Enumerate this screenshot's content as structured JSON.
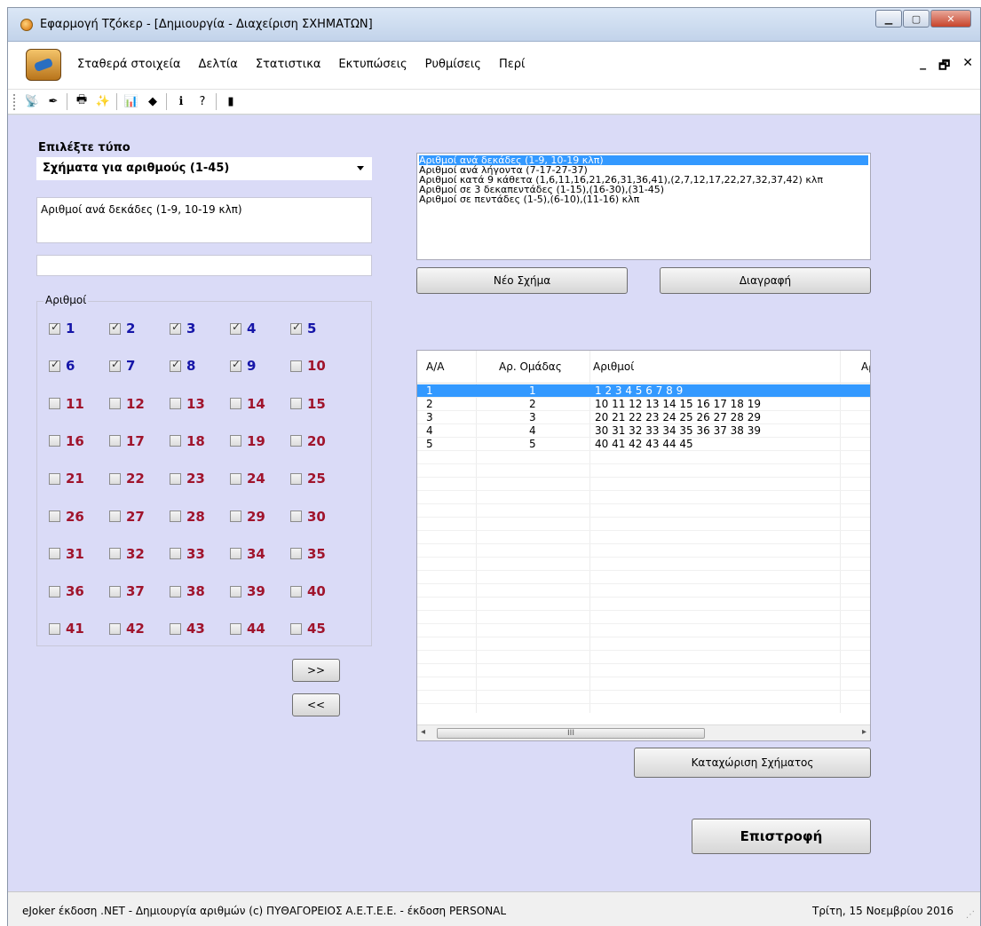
{
  "window": {
    "title": "Εφαρμογή Τζόκερ - [Δημιουργία - Διαχείριση ΣΧΗΜΑΤΩΝ]"
  },
  "menu": [
    "Σταθερά στοιχεία",
    "Δελτία",
    "Στατιστικα",
    "Εκτυπώσεις",
    "Ρυθμίσεις",
    "Περί"
  ],
  "toolbar_icons": [
    "satellite-icon",
    "pen-icon",
    "printer-icon",
    "wand-icon",
    "chart-icon",
    "cube-icon",
    "info-icon",
    "help-icon",
    "exit-door-icon"
  ],
  "left": {
    "type_label": "Επιλέξτε τύπο",
    "type_value": "Σχήματα για αριθμούς (1-45)",
    "description": "Αριθμοί ανά δεκάδες (1-9, 10-19 κλπ)",
    "name_value": "",
    "numbers_legend": "Αριθμοί",
    "numbers": [
      {
        "n": "1",
        "checked": true
      },
      {
        "n": "2",
        "checked": true
      },
      {
        "n": "3",
        "checked": true
      },
      {
        "n": "4",
        "checked": true
      },
      {
        "n": "5",
        "checked": true
      },
      {
        "n": "6",
        "checked": true
      },
      {
        "n": "7",
        "checked": true
      },
      {
        "n": "8",
        "checked": true
      },
      {
        "n": "9",
        "checked": true
      },
      {
        "n": "10",
        "checked": false
      },
      {
        "n": "11",
        "checked": false
      },
      {
        "n": "12",
        "checked": false
      },
      {
        "n": "13",
        "checked": false
      },
      {
        "n": "14",
        "checked": false
      },
      {
        "n": "15",
        "checked": false
      },
      {
        "n": "16",
        "checked": false
      },
      {
        "n": "17",
        "checked": false
      },
      {
        "n": "18",
        "checked": false
      },
      {
        "n": "19",
        "checked": false
      },
      {
        "n": "20",
        "checked": false
      },
      {
        "n": "21",
        "checked": false
      },
      {
        "n": "22",
        "checked": false
      },
      {
        "n": "23",
        "checked": false
      },
      {
        "n": "24",
        "checked": false
      },
      {
        "n": "25",
        "checked": false
      },
      {
        "n": "26",
        "checked": false
      },
      {
        "n": "27",
        "checked": false
      },
      {
        "n": "28",
        "checked": false
      },
      {
        "n": "29",
        "checked": false
      },
      {
        "n": "30",
        "checked": false
      },
      {
        "n": "31",
        "checked": false
      },
      {
        "n": "32",
        "checked": false
      },
      {
        "n": "33",
        "checked": false
      },
      {
        "n": "34",
        "checked": false
      },
      {
        "n": "35",
        "checked": false
      },
      {
        "n": "36",
        "checked": false
      },
      {
        "n": "37",
        "checked": false
      },
      {
        "n": "38",
        "checked": false
      },
      {
        "n": "39",
        "checked": false
      },
      {
        "n": "40",
        "checked": false
      },
      {
        "n": "41",
        "checked": false
      },
      {
        "n": "42",
        "checked": false
      },
      {
        "n": "43",
        "checked": false
      },
      {
        "n": "44",
        "checked": false
      },
      {
        "n": "45",
        "checked": false
      }
    ],
    "add_label": ">>",
    "remove_label": "<<"
  },
  "right": {
    "shapes": [
      "Αριθμοί ανά δεκάδες (1-9, 10-19 κλπ)",
      "Αριθμοί ανά λήγοντα (7-17-27-37)",
      "Αριθμοί κατά 9 κάθετα (1,6,11,16,21,26,31,36,41),(2,7,12,17,22,27,32,37,42) κλπ",
      "Αριθμοί σε 3 δεκαπεντάδες (1-15),(16-30),(31-45)",
      "Αριθμοί σε πεντάδες (1-5),(6-10),(11-16) κλπ"
    ],
    "selected_shape": 0,
    "new_label": "Νέο Σχήμα",
    "delete_label": "Διαγραφή",
    "grid_headers": [
      "Α/Α",
      "Αρ. Ομάδας",
      "Αριθμοί",
      "Αρ"
    ],
    "grid_rows": [
      {
        "aa": "1",
        "grp": "1",
        "nums": "1 2 3 4 5 6 7 8 9"
      },
      {
        "aa": "2",
        "grp": "2",
        "nums": "10 11 12 13 14 15 16 17 18 19"
      },
      {
        "aa": "3",
        "grp": "3",
        "nums": "20 21 22 23 24 25 26 27 28 29"
      },
      {
        "aa": "4",
        "grp": "4",
        "nums": "30 31 32 33 34 35 36 37 38 39"
      },
      {
        "aa": "5",
        "grp": "5",
        "nums": "40 41 42 43 44 45"
      }
    ],
    "selected_row": 0,
    "scroll_thumb": "III",
    "save_label": "Καταχώριση Σχήματος",
    "back_label": "Επιστροφή"
  },
  "status": {
    "left": "eJoker έκδοση .NET  - Δημιουργία αριθμών  (c) ΠΥΘΑΓΟΡΕΙΟΣ  Α.Ε.Τ.Ε.Ε.  - έκδοση PERSONAL",
    "right": "Τρίτη, 15 Νοεμβρίου 2016"
  },
  "colors": {
    "client_bg": "#dadbf7",
    "selection": "#3399ff",
    "checked_number": "#1515a8",
    "unchecked_number": "#a0142c"
  }
}
